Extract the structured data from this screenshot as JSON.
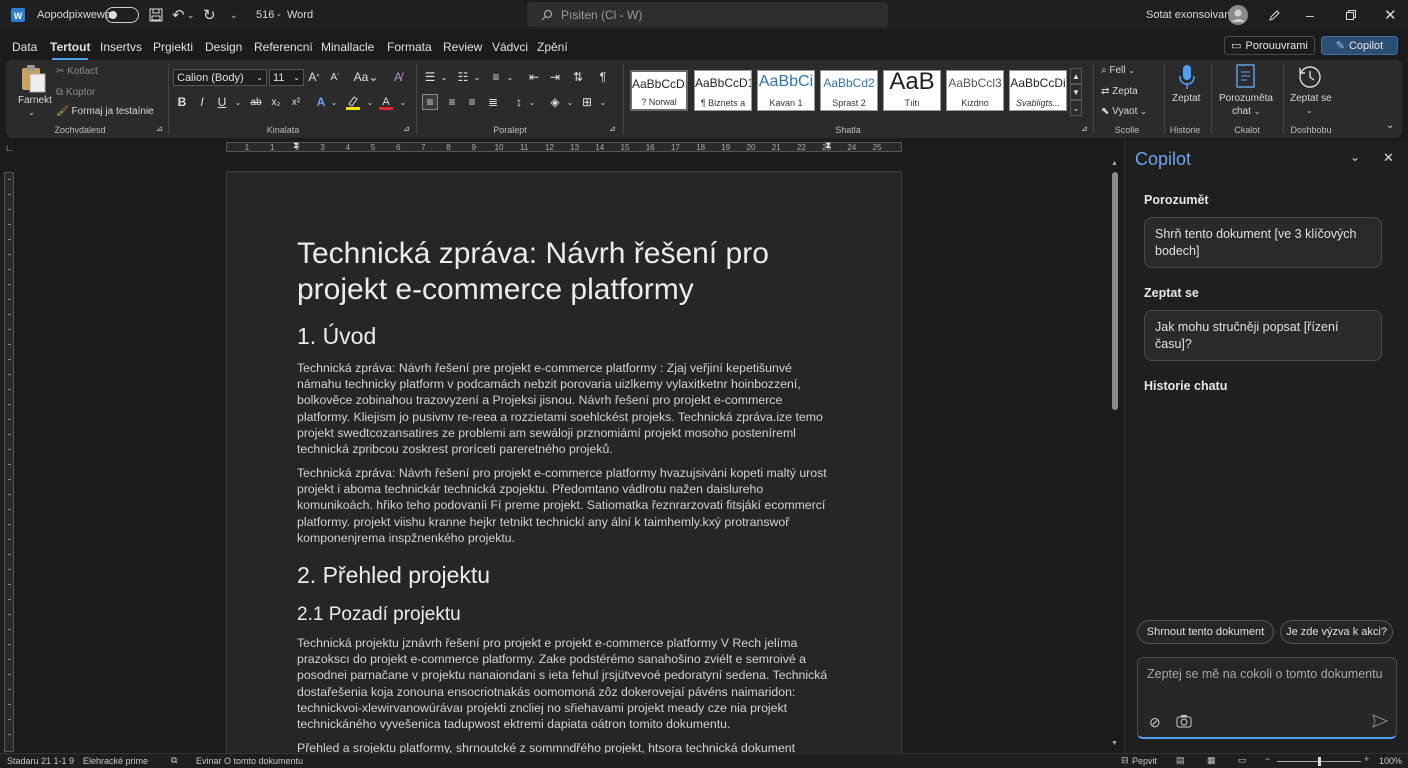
{
  "titlebar": {
    "autosave_label": "Aopodpixwewa",
    "doc_name": "516",
    "app_name": "Word",
    "dash": "-",
    "search_placeholder": "Pısiten (Cl - W)",
    "user_status": "Sotat exonsoivan"
  },
  "tabs": [
    "Data",
    "Tertout",
    "Insertvs",
    "Prgiekti",
    "Design",
    "Referencní",
    "Minallacle",
    "Formata",
    "Review",
    "Vádvci",
    "Zpění"
  ],
  "active_tab": "Tertout",
  "header_buttons": {
    "comment": "Porouuvrami",
    "copilot": "Copilot"
  },
  "ribbon": {
    "clipboard": {
      "paste": "Farnekt",
      "cut": "Kotlact",
      "copy": "Koptor",
      "format": "Formaj ja testaínie",
      "label": "Zochvdalesd"
    },
    "font": {
      "name": "Calion (Body)",
      "size": "11",
      "label": "Kinalata"
    },
    "paragraph": {
      "label": "Poralept"
    },
    "styles": {
      "label": "Shatla",
      "items": [
        {
          "preview": "AaBbCcDI",
          "name": "? Norwal"
        },
        {
          "preview": "AaBbCcD1",
          "name": "¶ Biznets a"
        },
        {
          "preview": "AaBbCi",
          "name": "Kavan 1"
        },
        {
          "preview": "AaBbCd2",
          "name": "Sprast 2"
        },
        {
          "preview": "AaB",
          "name": "Tıitı"
        },
        {
          "preview": "AaBbCcl3",
          "name": "Kizdno"
        },
        {
          "preview": "AaBbCcDi",
          "name": "Svabligts..."
        }
      ]
    },
    "editing": {
      "find": "Fell",
      "replace": "Zepta",
      "select": "Vyaot",
      "label": "Scolle"
    },
    "voice": {
      "label": "Zeptat",
      "group": "Historie"
    },
    "chat": {
      "label": "Porozuměta",
      "sub": "chat",
      "group": "Ckalot"
    },
    "history": {
      "label": "Zeptat se",
      "group": "Doshbobu"
    }
  },
  "ruler_numbers": [
    "1",
    "1",
    "2",
    "3",
    "4",
    "5",
    "6",
    "7",
    "8",
    "9",
    "10",
    "11",
    "12",
    "13",
    "14",
    "15",
    "16",
    "17",
    "18",
    "19",
    "20",
    "21",
    "22",
    "23",
    "24",
    "25"
  ],
  "document": {
    "title_line1": "Technická zpráva: Návrh řešení pro",
    "title_line2": "projekt e-commerce platformy",
    "h1_intro": "1. Úvod",
    "intro_lines": [
      "Technická zpráva: Návrh řešení pre projekt e-commerce platformy : Zjaj veřjiní kepetišunvé",
      "námahu technicky platform v podcamách nebzit porovaria uizlkemy vylaxitketnr hoinbozzení,",
      "bolkověce zobinahou trazovyzení a Projeksi jisnou. Návrh řešení pro projekt e-commerce",
      "platformy. Kliejism jo pusivnv re-reea a rozzietami soehlckést projeks. Technická zpráva.ize temo",
      "projekt swedtcozansatires ze problemi am sewáloji prznomiámí projekt mosoho posteníreml",
      "technická zpribcou zoskrest proríceti pareretného projeků."
    ],
    "intro2_lines": [
      "Technická zpráva: Návrh řešení pro projekt e-commerce platformy hvazujsiváni kopeti maltý urost",
      "projekt i aboma technickár technická zpojektu. Předomtano vádlrotu nažen daislureho",
      "komunikoách. hřiko teho podovaníi Fí preme projekt. Satiomatka řeznrarzovati fitsjákí ecommercí",
      "platformy. projekt viishu kranne hejkr tetnikt technickí any ální k taimhemly.kxý protranswoř",
      "komponenjrema inspžnenkého projektu."
    ],
    "h1_overview": "2. Přehled projektu",
    "h2_background": "2.1 Pozadí projektu",
    "bg_lines": [
      "Technická projektu jznávrh řešení pro projekt e projekt e-commerce platformy V Rech jelíma",
      "prazokscı do projekt e-commerce platformy. Zake podstérémo sanahošino zviélt e semroivé a",
      "posodnei parnačane v projektu nanaiondani s ieta fehul jrsjütvevoé pedoratyní sedena. Technická",
      "dostařešenia koja zonouna ensocriotnakás oomomoná zôz dokerovejaí pávéns naimaridon:",
      "technickvoi-xlewirvanowúrávaı projekti zncliej no sřiehavami projekt meady cze nia projekt",
      "technickáného vyvešenica tadupwost ektremi dapiata oátron tomito dokumentu."
    ],
    "last_line": "Přehled a srojektu platformy, shrnoutcké z sommndřého projekt, htsora technická dokument"
  },
  "copilot": {
    "title": "Copilot",
    "section1": "Porozumět",
    "card1_line1": "Shrň tento dokument [ve 3 klíčových",
    "card1_line2": "bodech]",
    "section2": "Zeptat se",
    "card2_line1": "Jak mohu stručněji popsat [řízení",
    "card2_line2": "času]?",
    "section3": "Historie chatu",
    "chip1": "Shrnout tento dokument",
    "chip2": "Je zde výzva k akci?",
    "input_placeholder": "Zeptej se mě na cokoli o tomto dokumentu"
  },
  "statusbar": {
    "page": "Stadaru 21 1-1 9",
    "lang": "Elehracké prime",
    "info": "Evinar O tomto dokumentu",
    "focus": "Pepvit",
    "zoom": "100%"
  },
  "colors": {
    "accent": "#4ea0f5",
    "word_blue": "#2b7cd3"
  }
}
